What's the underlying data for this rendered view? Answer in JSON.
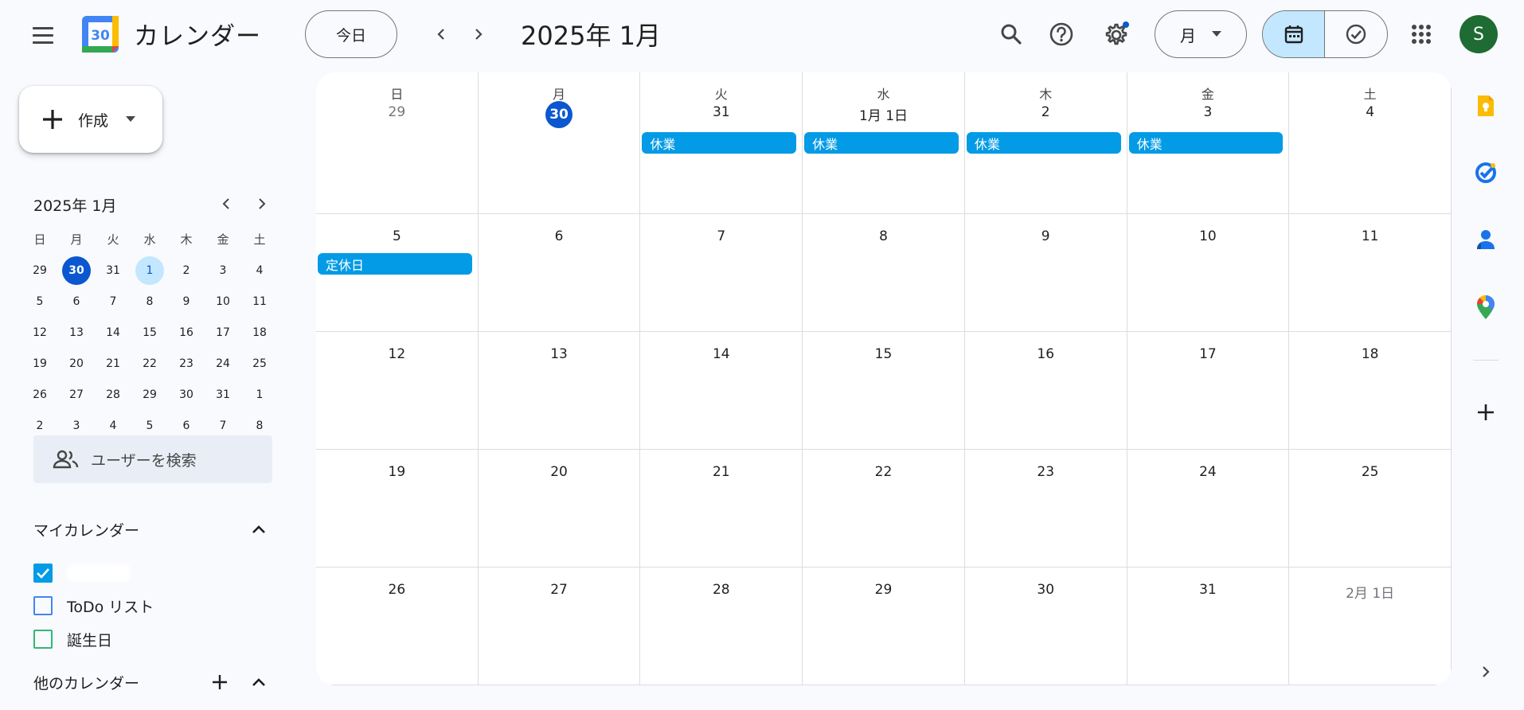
{
  "header": {
    "app_title": "カレンダー",
    "logo_day": "30",
    "today_label": "今日",
    "month_title": "2025年 1月",
    "view_select": "月",
    "avatar_letter": "S"
  },
  "create": {
    "label": "作成"
  },
  "mini": {
    "title": "2025年 1月",
    "dow": [
      "日",
      "月",
      "火",
      "水",
      "木",
      "金",
      "土"
    ],
    "weeks": [
      [
        "29",
        "30",
        "31",
        "1",
        "2",
        "3",
        "4"
      ],
      [
        "5",
        "6",
        "7",
        "8",
        "9",
        "10",
        "11"
      ],
      [
        "12",
        "13",
        "14",
        "15",
        "16",
        "17",
        "18"
      ],
      [
        "19",
        "20",
        "21",
        "22",
        "23",
        "24",
        "25"
      ],
      [
        "26",
        "27",
        "28",
        "29",
        "30",
        "31",
        "1"
      ],
      [
        "2",
        "3",
        "4",
        "5",
        "6",
        "7",
        "8"
      ]
    ]
  },
  "search_people": {
    "placeholder": "ユーザーを検索"
  },
  "my_calendars": {
    "title": "マイカレンダー",
    "items": [
      {
        "name": "",
        "checked": true,
        "color": "#039be5"
      },
      {
        "name": "ToDo リスト",
        "checked": false,
        "color": "#4285f4"
      },
      {
        "name": "誕生日",
        "checked": false,
        "color": "#33b679"
      }
    ]
  },
  "other_calendars": {
    "title": "他のカレンダー"
  },
  "month_grid": {
    "dow": [
      "日",
      "月",
      "火",
      "水",
      "木",
      "金",
      "土"
    ],
    "weeks": [
      [
        "29",
        "30",
        "31",
        "1月 1日",
        "2",
        "3",
        "4"
      ],
      [
        "5",
        "6",
        "7",
        "8",
        "9",
        "10",
        "11"
      ],
      [
        "12",
        "13",
        "14",
        "15",
        "16",
        "17",
        "18"
      ],
      [
        "19",
        "20",
        "21",
        "22",
        "23",
        "24",
        "25"
      ],
      [
        "26",
        "27",
        "28",
        "29",
        "30",
        "31",
        "2月 1日"
      ]
    ],
    "events": [
      {
        "week": 0,
        "day": 2,
        "title": "休業"
      },
      {
        "week": 0,
        "day": 3,
        "title": "休業"
      },
      {
        "week": 0,
        "day": 4,
        "title": "休業"
      },
      {
        "week": 0,
        "day": 5,
        "title": "休業"
      },
      {
        "week": 1,
        "day": 0,
        "title": "定休日"
      }
    ]
  },
  "colors": {
    "accent": "#0b57d0",
    "event": "#039be5",
    "selected": "#c2e7ff"
  }
}
